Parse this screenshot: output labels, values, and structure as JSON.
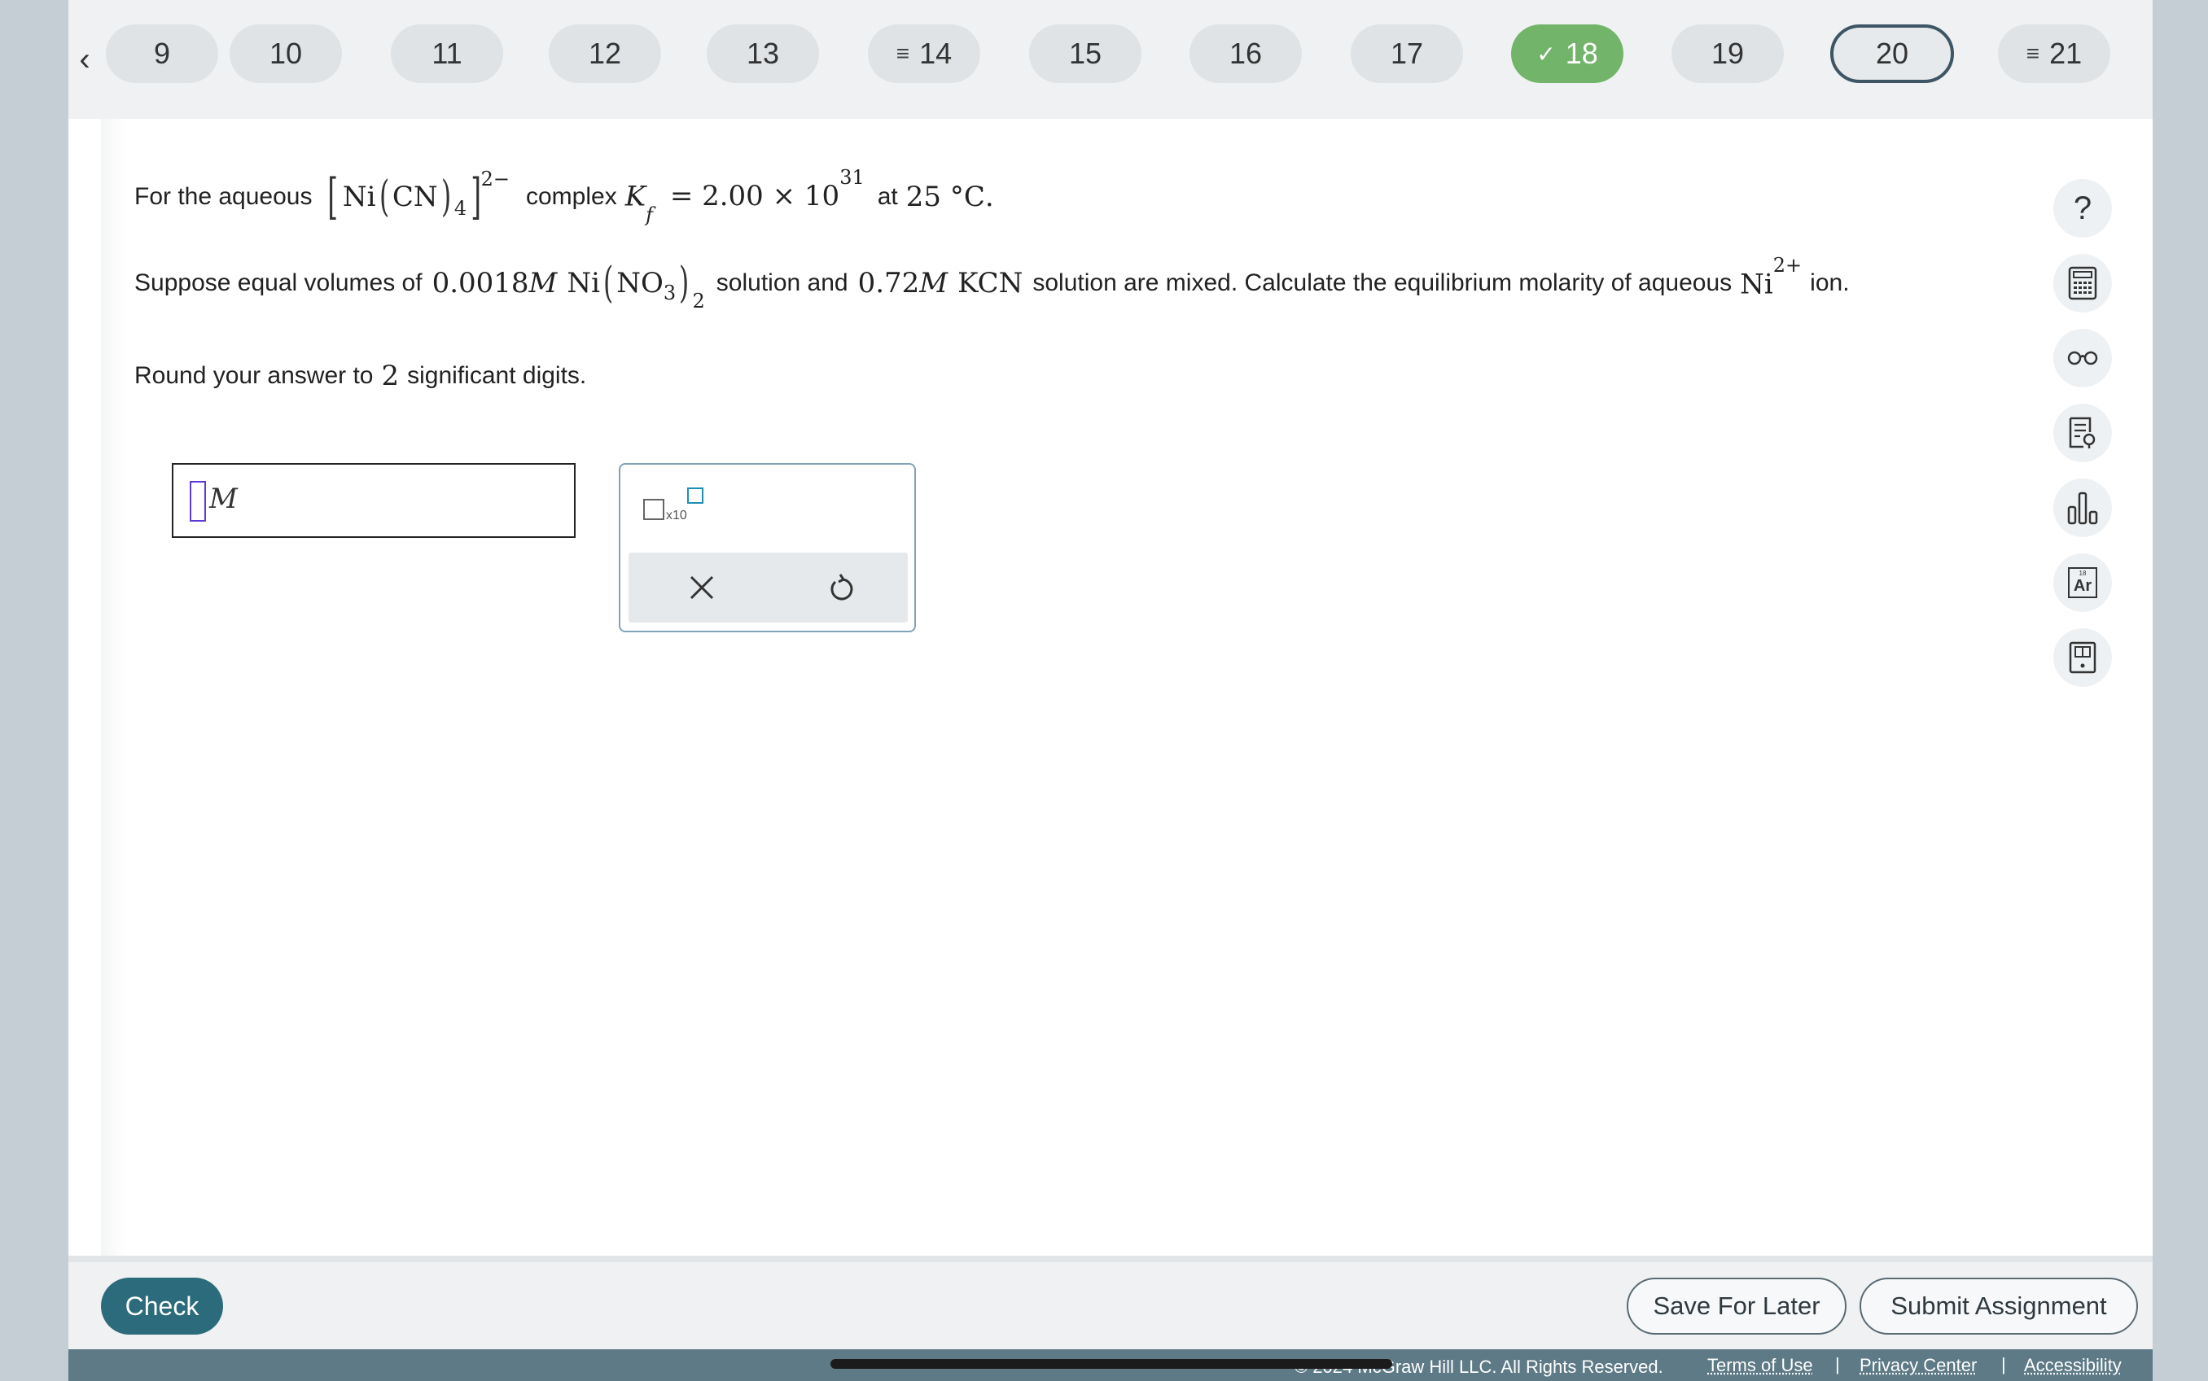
{
  "nav": {
    "prev_label": "‹",
    "questions": [
      {
        "label": "9",
        "status": "default"
      },
      {
        "label": "10",
        "status": "default"
      },
      {
        "label": "11",
        "status": "default"
      },
      {
        "label": "12",
        "status": "default"
      },
      {
        "label": "13",
        "status": "default"
      },
      {
        "label": "14",
        "status": "partial",
        "mark": "≡"
      },
      {
        "label": "15",
        "status": "default"
      },
      {
        "label": "16",
        "status": "default"
      },
      {
        "label": "17",
        "status": "default"
      },
      {
        "label": "18",
        "status": "done",
        "mark": "✓"
      },
      {
        "label": "19",
        "status": "default"
      },
      {
        "label": "20",
        "status": "current"
      },
      {
        "label": "21",
        "status": "partial",
        "mark": "≡"
      }
    ]
  },
  "question": {
    "line1": {
      "t1": "For the aqueous",
      "ni": "Ni",
      "cn": "CN",
      "cn_sub": "4",
      "charge": "2−",
      "t2": "complex",
      "k": "K",
      "k_sub": "f",
      "eq": "= 2.00 × 10",
      "exp": "31",
      "t3": "at",
      "temp": "25 °C",
      "period": "."
    },
    "line2": {
      "t1": "Suppose equal volumes of",
      "c1": "0.0018",
      "m1": "M",
      "ni": "Ni",
      "no3": "NO",
      "no3_sub": "3",
      "outer_sub": "2",
      "t2": "solution and",
      "c2": "0.72",
      "m2": "M",
      "kcn": "KCN",
      "t3": "solution are mixed. Calculate the equilibrium molarity of aqueous",
      "ion": "Ni",
      "ion_charge": "2+",
      "t4": "ion."
    },
    "line3": {
      "t1": "Round your answer to",
      "digits": "2",
      "t2": "significant digits."
    }
  },
  "answer": {
    "unit": "M"
  },
  "toolbox": {
    "x10": "x10"
  },
  "footer": {
    "check": "Check",
    "save": "Save For Later",
    "submit": "Submit Assignment",
    "copyright": "© 2024 McGraw Hill LLC. All Rights Reserved.",
    "terms": "Terms of Use",
    "privacy": "Privacy Center",
    "accessibility": "Accessibility",
    "sep": "|"
  },
  "sidebar": {
    "help": "?",
    "periodic_number": "18",
    "periodic_symbol": "Ar"
  },
  "colors": {
    "done": "#72b46a",
    "check_button": "#2c6b7b",
    "footer_bar": "#5d7a86",
    "toolbox_border": "#7fa3b8",
    "cursor": "#5b3ad8"
  }
}
